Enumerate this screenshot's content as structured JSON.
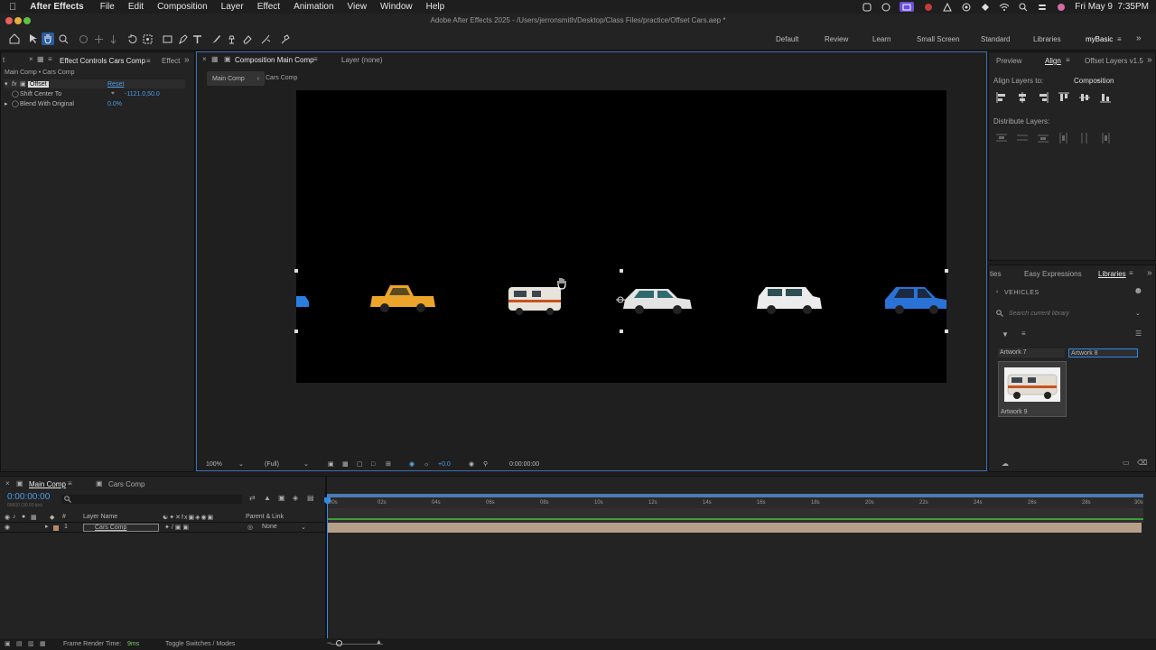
{
  "menubar": {
    "app_name": "After Effects",
    "items": [
      "File",
      "Edit",
      "Composition",
      "Layer",
      "Effect",
      "Animation",
      "View",
      "Window",
      "Help"
    ],
    "datetime": "Fri May 9  7:35PM"
  },
  "window": {
    "title": "Adobe After Effects 2025 - /Users/jerronsmith/Desktop/Class Files/practice/Offset Cars.aep *"
  },
  "workspaces": [
    "Default",
    "Review",
    "Learn",
    "Small Screen",
    "Standard",
    "Libraries",
    "myBasic"
  ],
  "effect_controls": {
    "tab_label": "Effect Controls Cars Comp",
    "tab_label_2": "Effect",
    "breadcrumb": "Main Comp • Cars Comp",
    "effect_name": "Offset",
    "reset_label": "Reset",
    "params": [
      {
        "label": "Shift Center To",
        "value": "-1121.0,50.0"
      },
      {
        "label": "Blend With Original",
        "value": "0.0%"
      }
    ]
  },
  "composition": {
    "tab_label": "Composition Main Comp",
    "layer_tab": "Layer (none)",
    "breadcrumbs": [
      "Main Comp",
      "Cars Comp"
    ],
    "footer": {
      "zoom": "100%",
      "resolution": "(Full)",
      "exposure": "+0.0",
      "timecode": "0:00:00:00"
    }
  },
  "align_panel": {
    "tabs": [
      "Preview",
      "Align",
      "Offset Layers v1.5"
    ],
    "align_to_label": "Align Layers to:",
    "align_to_value": "Composition",
    "distribute_label": "Distribute Layers:"
  },
  "libraries_panel": {
    "tabs": [
      "ties",
      "Easy Expressions",
      "Libraries"
    ],
    "library_name": "VEHICLES",
    "search_placeholder": "Search current library",
    "items": [
      "Artwork 7",
      "Artwork 8",
      "Artwork 9"
    ]
  },
  "timeline": {
    "tabs": [
      "Main Comp",
      "Cars Comp"
    ],
    "timecode": "0:00:00:00",
    "subtimecode": "00000 (30.00 fps)",
    "columns": {
      "number": "#",
      "layer_name": "Layer Name",
      "parent": "Parent & Link"
    },
    "layers": [
      {
        "index": "1",
        "name": "Cars Comp",
        "parent": "None"
      }
    ],
    "ruler": [
      "00s",
      "02s",
      "04s",
      "06s",
      "08s",
      "10s",
      "12s",
      "14s",
      "16s",
      "18s",
      "20s",
      "22s",
      "24s",
      "26s",
      "28s",
      "30s"
    ]
  },
  "statusbar": {
    "render_label": "Frame Render Time:",
    "render_value": "9ms",
    "toggle_label": "Toggle Switches / Modes"
  },
  "colors": {
    "accent_blue": "#2d8ceb",
    "track_green": "#3f9c3a",
    "viewer_border": "#3b6fb0"
  }
}
